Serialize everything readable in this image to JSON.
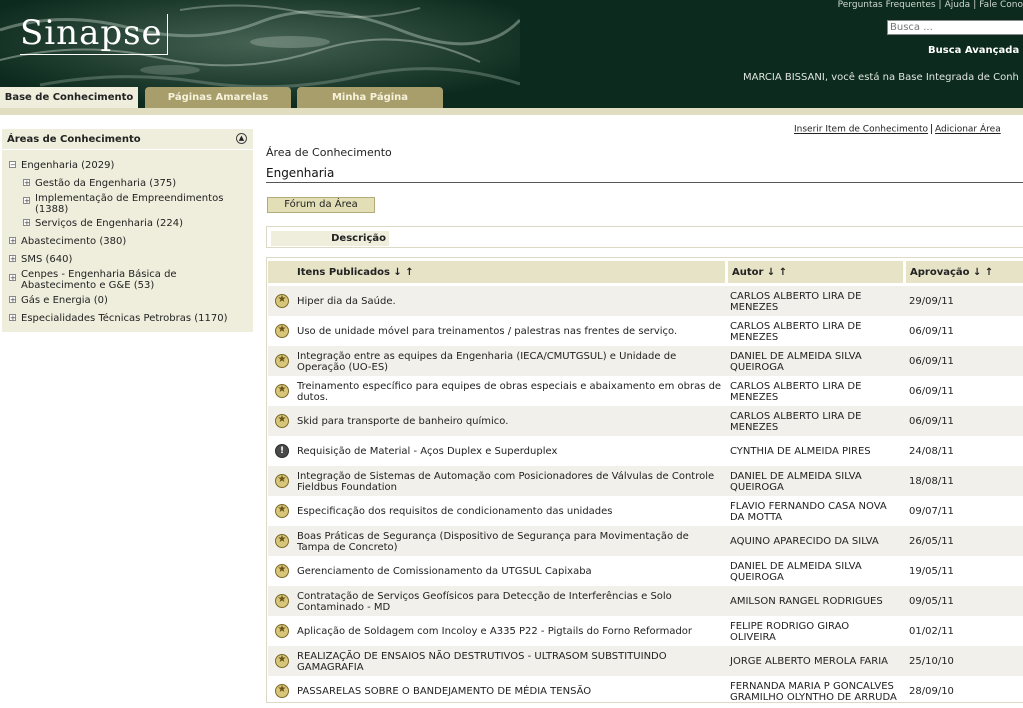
{
  "header": {
    "logo": "Sinapse",
    "top_links": [
      "Perguntas Frequentes",
      "Ajuda",
      "Fale Cono"
    ],
    "search_placeholder": "Busca ...",
    "advanced_search": "Busca Avançada",
    "welcome": "MARCIA BISSANI, você está na Base Integrada de Conh"
  },
  "tabs": [
    {
      "label": "Base de Conhecimento"
    },
    {
      "label": "Páginas Amarelas"
    },
    {
      "label": "Minha Página"
    }
  ],
  "sidebar": {
    "title": "Áreas de Conhecimento",
    "items": [
      {
        "label": "Engenharia (2029)",
        "expanded": true
      },
      {
        "label": "Gestão da Engenharia (375)"
      },
      {
        "label": "Implementação de Empreendimentos",
        "label2": "(1388)"
      },
      {
        "label": "Serviços de Engenharia (224)"
      },
      {
        "label": "Abastecimento (380)"
      },
      {
        "label": "SMS (640)"
      },
      {
        "label": "Cenpes - Engenharia Básica de",
        "label2": "Abastecimento e G&E (53)"
      },
      {
        "label": "Gás e Energia (0)"
      },
      {
        "label": "Especialidades Técnicas Petrobras (1170)"
      }
    ]
  },
  "main": {
    "links": [
      "Inserir Item de Conhecimento",
      "Adicionar Área"
    ],
    "area_label": "Área de Conhecimento",
    "area_name": "Engenharia",
    "forum_button": "Fórum da Área",
    "description_label": "Descrição",
    "table": {
      "headers": [
        "Itens Publicados ↓ ↑",
        "Autor ↓ ↑",
        "Aprovação ↓ ↑"
      ],
      "rows": [
        {
          "icon": "star",
          "title": "Hiper dia da Saúde.",
          "title2": "",
          "author": "CARLOS ALBERTO LIRA DE",
          "author2": "MENEZES",
          "date": "29/09/11"
        },
        {
          "icon": "star",
          "title": "Uso de unidade móvel para treinamentos / palestras nas frentes de serviço.",
          "title2": "",
          "author": "CARLOS ALBERTO LIRA DE",
          "author2": "MENEZES",
          "date": "06/09/11"
        },
        {
          "icon": "star",
          "title": "Integração entre as equipes da Engenharia (IECA/CMUTGSUL) e Unidade de",
          "title2": "Operação (UO-ES)",
          "author": "DANIEL DE ALMEIDA SILVA",
          "author2": "QUEIROGA",
          "date": "06/09/11"
        },
        {
          "icon": "star",
          "title": "Treinamento específico para equipes de obras especiais e abaixamento em obras de",
          "title2": "dutos.",
          "author": "CARLOS ALBERTO LIRA DE",
          "author2": "MENEZES",
          "date": "06/09/11"
        },
        {
          "icon": "star",
          "title": "Skid para transporte de banheiro químico.",
          "title2": "",
          "author": "CARLOS ALBERTO LIRA DE",
          "author2": "MENEZES",
          "date": "06/09/11"
        },
        {
          "icon": "alert",
          "title": "Requisição de Material - Aços Duplex e Superduplex",
          "title2": "",
          "author": "CYNTHIA DE ALMEIDA PIRES",
          "author2": "",
          "date": "24/08/11"
        },
        {
          "icon": "star",
          "title": "Integração de Sistemas de Automação com Posicionadores de Válvulas de Controle",
          "title2": "Fieldbus Foundation",
          "author": "DANIEL DE ALMEIDA SILVA",
          "author2": "QUEIROGA",
          "date": "18/08/11"
        },
        {
          "icon": "star",
          "title": "Especificação dos requisitos de condicionamento das unidades",
          "title2": "",
          "author": "FLAVIO FERNANDO CASA NOVA",
          "author2": "DA MOTTA",
          "date": "09/07/11"
        },
        {
          "icon": "star",
          "title": "Boas Práticas de Segurança (Dispositivo de Segurança para Movimentação de",
          "title2": "Tampa de Concreto)",
          "author": "AQUINO APARECIDO DA SILVA",
          "author2": "",
          "date": "26/05/11"
        },
        {
          "icon": "star",
          "title": "Gerenciamento de Comissionamento da UTGSUL Capixaba",
          "title2": "",
          "author": "DANIEL DE ALMEIDA SILVA",
          "author2": "QUEIROGA",
          "date": "19/05/11"
        },
        {
          "icon": "star",
          "title": "Contratação de Serviços Geofísicos para Detecção de Interferências e Solo",
          "title2": "Contaminado - MD",
          "author": "AMILSON RANGEL RODRIGUES",
          "author2": "",
          "date": "09/05/11"
        },
        {
          "icon": "star",
          "title": "Aplicação de Soldagem com Incoloy e A335 P22 - Pigtails do Forno Reformador",
          "title2": "",
          "author": "FELIPE RODRIGO GIRAO",
          "author2": "OLIVEIRA",
          "date": "01/02/11"
        },
        {
          "icon": "star",
          "title": "REALIZAÇÃO DE ENSAIOS NÃO DESTRUTIVOS - ULTRASOM SUBSTITUINDO",
          "title2": "GAMAGRAFIA",
          "author": "JORGE ALBERTO MEROLA FARIA",
          "author2": "",
          "date": "25/10/10"
        },
        {
          "icon": "star",
          "title": "PASSARELAS SOBRE O BANDEJAMENTO DE MÉDIA TENSÃO",
          "title2": "",
          "author": "FERNANDA MARIA P GONCALVES",
          "author2": "GRAMILHO OLYNTHO DE ARRUDA",
          "date": "28/09/10"
        }
      ]
    }
  }
}
